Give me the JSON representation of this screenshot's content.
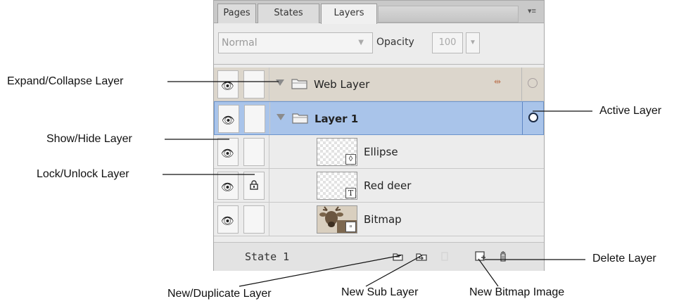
{
  "panel": {
    "tabs": [
      {
        "label": "Pages"
      },
      {
        "label": "States"
      },
      {
        "label": "Layers"
      }
    ],
    "blend_mode": "Normal",
    "opacity_label": "Opacity",
    "opacity_value": "100",
    "layers": [
      {
        "name": "Web Layer",
        "type": "folder"
      },
      {
        "name": "Layer 1",
        "type": "folder",
        "active": true
      },
      {
        "name": "Ellipse",
        "type": "object"
      },
      {
        "name": "Red deer",
        "type": "object",
        "locked": true
      },
      {
        "name": "Bitmap",
        "type": "object"
      }
    ],
    "state_label": "State 1"
  },
  "callouts": {
    "expand_collapse": "Expand/Collapse Layer",
    "show_hide": "Show/Hide Layer",
    "lock_unlock": "Lock/Unlock Layer",
    "active": "Active Layer",
    "delete": "Delete Layer",
    "new_duplicate": "New/Duplicate Layer",
    "new_sub": "New Sub Layer",
    "new_bitmap": "New Bitmap Image"
  },
  "colors": {
    "active_row": "#a9c4ea",
    "web_row": "#dcd6cc"
  }
}
